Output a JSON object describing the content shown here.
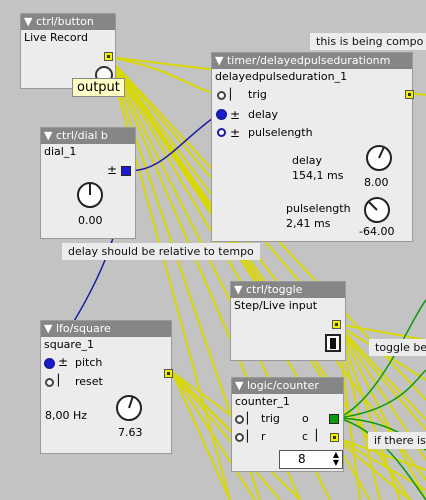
{
  "objects": {
    "button": {
      "type": "▼ ctrl/button",
      "name": "Live Record"
    },
    "timer": {
      "type": "▼ timer/delayedpulsedurationm",
      "name": "delayedpulseduration_1",
      "in_trig": "trig",
      "in_delay": "delay",
      "in_pulselength": "pulselength",
      "delay_label": "delay",
      "delay_value": "154,1 ms",
      "delay_knob": "8.00",
      "pulse_label": "pulselength",
      "pulse_value": "2,41 ms",
      "pulse_knob": "-64.00"
    },
    "dial": {
      "type": "▼ ctrl/dial b",
      "name": "dial_1",
      "knob": "0.00"
    },
    "toggle": {
      "type": "▼ ctrl/toggle",
      "name": "Step/Live input"
    },
    "lfo": {
      "type": "▼ lfo/square",
      "name": "square_1",
      "in_pitch": "pitch",
      "in_reset": "reset",
      "freq": "8,00 Hz",
      "knob": "7.63"
    },
    "counter": {
      "type": "▼ logic/counter",
      "name": "counter_1",
      "in_trig": "trig",
      "in_r": "r",
      "out_o": "o",
      "out_c": "c",
      "value": "8"
    }
  },
  "comments": {
    "top": "this is being compo",
    "delay_tempo": "delay should be relative to tempo",
    "toggle_be": "toggle be",
    "if_there": "if there is"
  },
  "tooltip": "output",
  "symbols": {
    "plusminus": "±"
  },
  "colors": {
    "wire_yellow": "#e8e800",
    "wire_blue": "#1a1aa0",
    "wire_green": "#0a9a0a",
    "header": "#868686"
  }
}
